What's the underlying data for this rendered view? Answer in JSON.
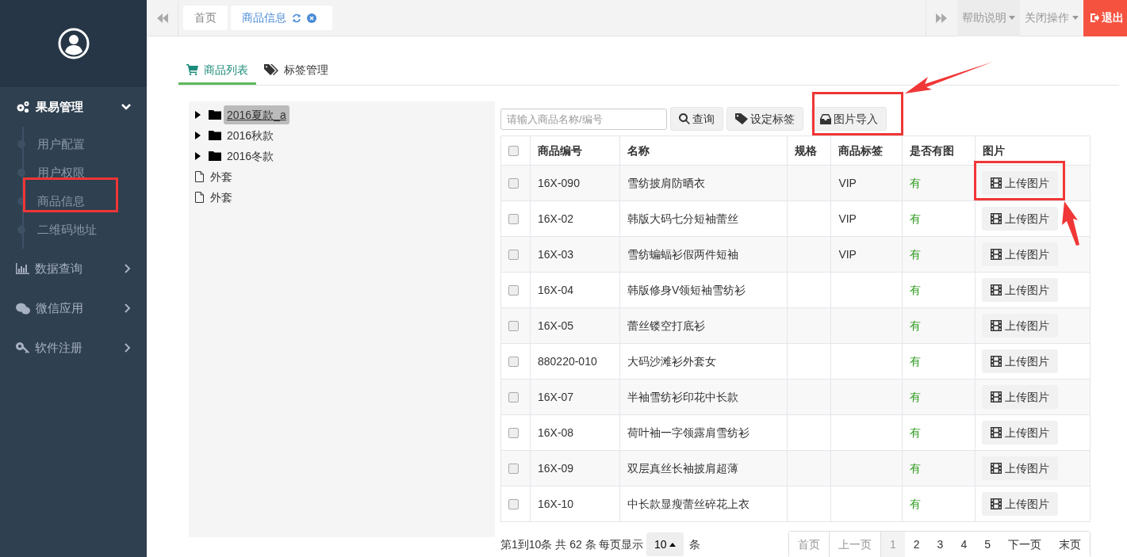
{
  "sidebar": {
    "groups": [
      {
        "label": "果易管理",
        "expanded": true,
        "children": [
          {
            "label": "用户配置"
          },
          {
            "label": "用户权限"
          },
          {
            "label": "商品信息"
          },
          {
            "label": "二维码地址"
          }
        ]
      },
      {
        "label": "数据查询",
        "expanded": false
      },
      {
        "label": "微信应用",
        "expanded": false
      },
      {
        "label": "软件注册",
        "expanded": false
      }
    ]
  },
  "topbar": {
    "tabs": [
      {
        "label": "首页",
        "selected": false
      },
      {
        "label": "商品信息",
        "selected": true
      }
    ],
    "menus": [
      "帮助说明",
      "关闭操作"
    ],
    "logout": "退出"
  },
  "page_tabs": [
    {
      "label": "商品列表",
      "selected": true
    },
    {
      "label": "标签管理",
      "selected": false
    }
  ],
  "tree": [
    {
      "label": "2016夏款_a",
      "kind": "folder",
      "selected": true
    },
    {
      "label": "2016秋款",
      "kind": "folder",
      "selected": false
    },
    {
      "label": "2016冬款",
      "kind": "folder",
      "selected": false
    },
    {
      "label": "外套",
      "kind": "file",
      "selected": false
    },
    {
      "label": "外套",
      "kind": "file",
      "selected": false
    }
  ],
  "search": {
    "placeholder": "请输入商品名称/编号"
  },
  "toolbar": [
    {
      "label": "查询"
    },
    {
      "label": "设定标签"
    },
    {
      "label": "图片导入"
    }
  ],
  "table": {
    "columns": [
      "商品编号",
      "名称",
      "规格",
      "商品标签",
      "是否有图",
      "图片"
    ],
    "select_all": false,
    "rows": [
      {
        "checked": false,
        "code": "16X-090",
        "name": "雪纺披肩防晒衣",
        "tag": "VIP",
        "has_image": "有",
        "button": "上传图片"
      },
      {
        "checked": false,
        "code": "16X-02",
        "name": "韩版大码七分短袖蕾丝",
        "tag": "VIP",
        "has_image": "有",
        "button": "上传图片"
      },
      {
        "checked": false,
        "code": "16X-03",
        "name": "雪纺蝙蝠衫假两件短袖",
        "tag": "VIP",
        "has_image": "有",
        "button": "上传图片"
      },
      {
        "checked": false,
        "code": "16X-04",
        "name": "韩版修身V领短袖雪纺衫",
        "has_image": "有",
        "button": "上传图片"
      },
      {
        "checked": false,
        "code": "16X-05",
        "name": "蕾丝镂空打底衫",
        "has_image": "有",
        "button": "上传图片"
      },
      {
        "checked": false,
        "code": "880220-010",
        "name": "大码沙滩衫外套女",
        "has_image": "有",
        "button": "上传图片"
      },
      {
        "checked": false,
        "code": "16X-07",
        "name": "半袖雪纺衫印花中长款",
        "has_image": "有",
        "button": "上传图片"
      },
      {
        "checked": false,
        "code": "16X-08",
        "name": "荷叶袖一字领露肩雪纺衫",
        "has_image": "有",
        "button": "上传图片"
      },
      {
        "checked": false,
        "code": "16X-09",
        "name": "双层真丝长袖披肩超薄",
        "has_image": "有",
        "button": "上传图片"
      },
      {
        "checked": false,
        "code": "16X-10",
        "name": "中长款显瘦蕾丝碎花上衣",
        "has_image": "有",
        "button": "上传图片"
      }
    ]
  },
  "pagination": {
    "summary": "第1到10条 共 62 条 每页显示",
    "page_size": "10",
    "unit": "条",
    "pages": [
      {
        "label": "首页",
        "disabled": true,
        "selected": false
      },
      {
        "label": "上一页",
        "disabled": true,
        "selected": false
      },
      {
        "label": "1",
        "disabled": false,
        "selected": true
      },
      {
        "label": "2",
        "disabled": false,
        "selected": false
      },
      {
        "label": "3",
        "disabled": false,
        "selected": false
      },
      {
        "label": "4",
        "disabled": false,
        "selected": false
      },
      {
        "label": "5",
        "disabled": false,
        "selected": false
      },
      {
        "label": "下一页",
        "disabled": false,
        "selected": false
      },
      {
        "label": "末页",
        "disabled": false,
        "selected": false
      }
    ]
  }
}
